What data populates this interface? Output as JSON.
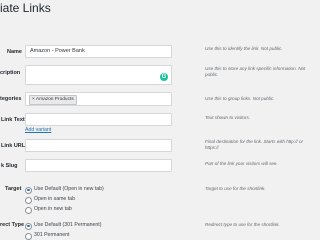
{
  "page": {
    "title": "iate Links"
  },
  "fields": {
    "name": {
      "label": "Name",
      "value": "Amazon - Power Bank",
      "help": "Use this to identify the link. Not public."
    },
    "description": {
      "label": "cription",
      "help": "Use this to store any link specific information. Not public."
    },
    "categories": {
      "label": "tegories",
      "tag": "× Amazon Products",
      "help": "Use this to group links. Not public."
    },
    "link_text": {
      "label": "Link Text",
      "help": "Text shown to visitors.",
      "add_variant": "Add variant"
    },
    "link_url": {
      "label": "Link URL",
      "help": "Final destination for the link. Starts with http:// or https://"
    },
    "link_slug": {
      "label": "k Slug",
      "help": "Part of the link your visitors will see."
    },
    "target": {
      "label": "Target",
      "options": [
        "Use Default (Open in new tab)",
        "Open in same tab",
        "Open in new tab"
      ],
      "selected": 0,
      "help": "Target to use for the shortlink."
    },
    "redirect_type": {
      "label": "rect Type",
      "options": [
        "Use Default (301 Permanent)",
        "301 Permanent"
      ],
      "selected": 0,
      "help": "Redirect type to use for the shortlink."
    }
  }
}
